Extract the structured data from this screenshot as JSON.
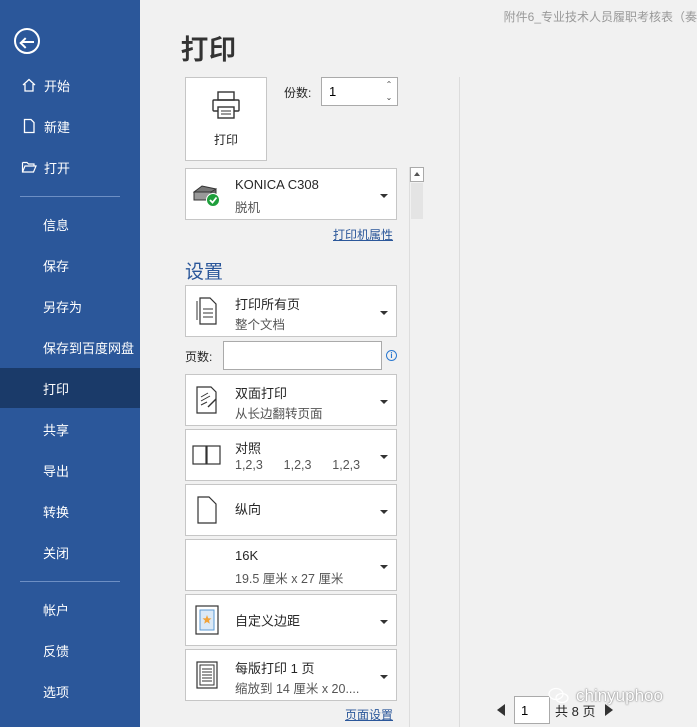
{
  "document_title": "附件6_专业技术人员履职考核表（奏",
  "page_title": "打印",
  "sidebar": {
    "items_top": [
      {
        "label": "开始",
        "icon": "home-icon"
      },
      {
        "label": "新建",
        "icon": "new-document-icon"
      },
      {
        "label": "打开",
        "icon": "folder-open-icon"
      }
    ],
    "items_mid": [
      "信息",
      "保存",
      "另存为",
      "保存到百度网盘",
      "打印",
      "共享",
      "导出",
      "转换",
      "关闭"
    ],
    "items_bottom": [
      "帐户",
      "反馈",
      "选项"
    ],
    "active": "打印"
  },
  "print": {
    "button_label": "打印",
    "copies_label": "份数:",
    "copies_value": "1"
  },
  "printer": {
    "name": "KONICA  C308",
    "status": "脱机",
    "properties_link": "打印机属性"
  },
  "settings": {
    "title": "设置",
    "pages_label": "页数:",
    "pages_value": "",
    "info_glyph": "i",
    "dropdowns": [
      {
        "line1": "打印所有页",
        "line2": "整个文档",
        "icon": "print-pages-icon"
      },
      {
        "line1": "双面打印",
        "line2": "从长边翻转页面",
        "icon": "duplex-print-icon"
      },
      {
        "line1": "对照",
        "line2": "1,2,3      1,2,3      1,2,3",
        "icon": "collate-icon"
      },
      {
        "line1": "纵向",
        "line2": "",
        "icon": "portrait-orientation-icon"
      },
      {
        "line1": "16K",
        "line2": "19.5 厘米 x 27 厘米",
        "icon": "paper-size-icon"
      },
      {
        "line1": "自定义边距",
        "line2": "",
        "icon": "custom-margins-icon"
      },
      {
        "line1": "每版打印 1 页",
        "line2": "缩放到 14 厘米 x 20....",
        "icon": "pages-per-sheet-icon"
      }
    ],
    "page_setup_link": "页面设置"
  },
  "pager": {
    "current": "1",
    "total_text": "共 8 页"
  },
  "watermark": "chinyuphoo"
}
